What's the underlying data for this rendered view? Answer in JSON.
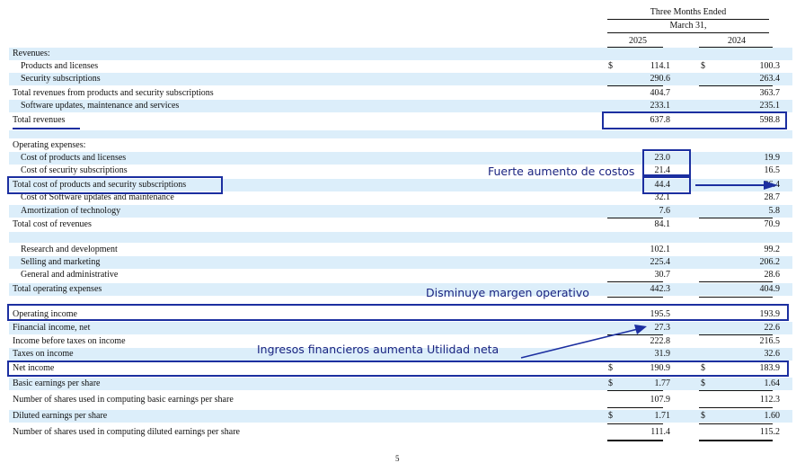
{
  "header": {
    "period_label": "Three Months Ended",
    "date_label": "March 31,",
    "year_current": "2025",
    "year_prior": "2024"
  },
  "rows": [
    {
      "id": "revenues-heading",
      "label": "Revenues:"
    },
    {
      "id": "products-licenses",
      "label": "Products and licenses",
      "v2025": "114.1",
      "v2024": "100.3",
      "currency": "$"
    },
    {
      "id": "security-subscriptions",
      "label": "Security subscriptions",
      "v2025": "290.6",
      "v2024": "263.4"
    },
    {
      "id": "total-rev-products-security",
      "label": "Total revenues from products and security subscriptions",
      "v2025": "404.7",
      "v2024": "363.7"
    },
    {
      "id": "software-updates",
      "label": "Software updates, maintenance and services",
      "v2025": "233.1",
      "v2024": "235.1"
    },
    {
      "id": "total-revenues",
      "label": "Total revenues",
      "v2025": "637.8",
      "v2024": "598.8"
    },
    {
      "id": "opex-heading",
      "label": "Operating expenses:"
    },
    {
      "id": "cost-products-licenses",
      "label": "Cost of products and licenses",
      "v2025": "23.0",
      "v2024": "19.9"
    },
    {
      "id": "cost-security-subscriptions",
      "label": "Cost of security subscriptions",
      "v2025": "21.4",
      "v2024": "16.5"
    },
    {
      "id": "total-cost-products-security",
      "label": "Total cost of products and security subscriptions",
      "v2025": "44.4",
      "v2024": "36.4"
    },
    {
      "id": "cost-software-updates",
      "label": "Cost of Software updates and maintenance",
      "v2025": "32.1",
      "v2024": "28.7"
    },
    {
      "id": "amortization",
      "label": "Amortization of technology",
      "v2025": "7.6",
      "v2024": "5.8"
    },
    {
      "id": "total-cost-revenues",
      "label": "Total cost of revenues",
      "v2025": "84.1",
      "v2024": "70.9"
    },
    {
      "id": "research-development",
      "label": "Research and development",
      "v2025": "102.1",
      "v2024": "99.2"
    },
    {
      "id": "selling-marketing",
      "label": "Selling and marketing",
      "v2025": "225.4",
      "v2024": "206.2"
    },
    {
      "id": "general-administrative",
      "label": "General and administrative",
      "v2025": "30.7",
      "v2024": "28.6"
    },
    {
      "id": "total-operating-expenses",
      "label": "Total operating expenses",
      "v2025": "442.3",
      "v2024": "404.9"
    },
    {
      "id": "operating-income",
      "label": "Operating income",
      "v2025": "195.5",
      "v2024": "193.9"
    },
    {
      "id": "financial-income",
      "label": "Financial income, net",
      "v2025": "27.3",
      "v2024": "22.6"
    },
    {
      "id": "income-before-taxes",
      "label": "Income before taxes on income",
      "v2025": "222.8",
      "v2024": "216.5"
    },
    {
      "id": "taxes-on-income",
      "label": "Taxes on income",
      "v2025": "31.9",
      "v2024": "32.6"
    },
    {
      "id": "net-income",
      "label": "Net income",
      "v2025": "190.9",
      "v2024": "183.9",
      "currency": "$"
    },
    {
      "id": "basic-eps",
      "label": "Basic earnings per share",
      "v2025": "1.77",
      "v2024": "1.64",
      "currency": "$"
    },
    {
      "id": "shares-basic",
      "label": "Number of shares used in computing basic earnings per share",
      "v2025": "107.9",
      "v2024": "112.3"
    },
    {
      "id": "diluted-eps",
      "label": "Diluted earnings per share",
      "v2025": "1.71",
      "v2024": "1.60",
      "currency": "$"
    },
    {
      "id": "shares-diluted",
      "label": "Number of shares used in computing diluted earnings per share",
      "v2025": "111.4",
      "v2024": "115.2"
    }
  ],
  "annotations": {
    "costs": "Fuerte aumento de costos",
    "margin": "Disminuye margen operativo",
    "financial": "Ingresos financieros aumenta Utilidad neta"
  },
  "footer": {
    "page_number": "5"
  },
  "colors": {
    "annotation": "#1c2fa0",
    "row_shade": "#dceefa"
  }
}
